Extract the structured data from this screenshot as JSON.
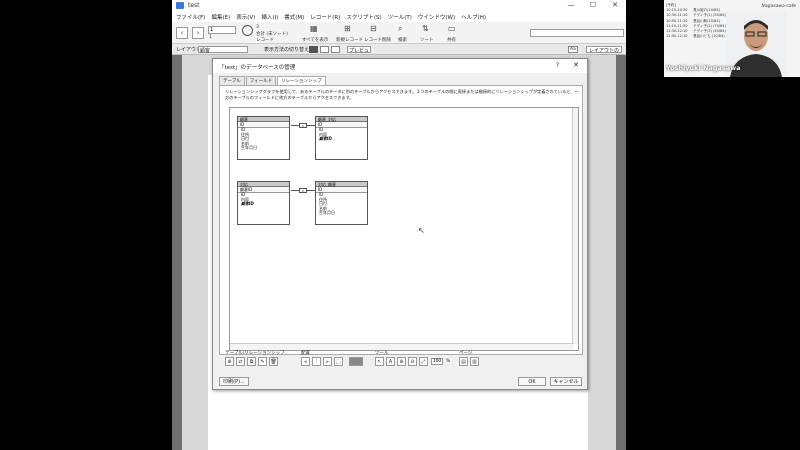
{
  "window": {
    "title": "test"
  },
  "menu": [
    "ファイル(F)",
    "編集(E)",
    "表示(V)",
    "挿入(I)",
    "書式(M)",
    "レコード(R)",
    "スクリプト(S)",
    "ツール(T)",
    "ウインドウ(W)",
    "ヘルプ(H)"
  ],
  "toolbar": {
    "record_number": "1",
    "record_total": "1",
    "found_count": "3",
    "found_label": "合計 (未ソート)",
    "records_label": "レコード",
    "show_all": "すべてを表示",
    "new_record": "新規レコード",
    "delete_record": "レコード削除",
    "find": "検索",
    "sort": "ソート",
    "share": "共有"
  },
  "layoutbar": {
    "layout_label": "レイアウト:",
    "layout_value": "顧客",
    "view_label": "表示方法の切り替え:",
    "preview": "プレビュー",
    "aa": "Aa",
    "edit_layout": "レイアウトの編集"
  },
  "dialog": {
    "title": "「test」のデータベースの管理",
    "help": "?",
    "close": "✕",
    "tabs": [
      "テーブル",
      "フィールド",
      "リレーションシップ"
    ],
    "active_tab": 2,
    "description": "リレーションシップグラフを使用して、あるテーブルのデータに別のテーブルからアクセスできます。２つのテーブルの間に直接または間接的にリレーションシップが定義されていると、一方のテーブルのフィールドに他方のテーブルからアクセスできます。",
    "tables": [
      {
        "name": "顧客",
        "key": "ID",
        "fields": [
          "ID",
          "住所",
          "日付",
          "名前",
          "生年月日"
        ],
        "italic": []
      },
      {
        "name": "顧客_対応",
        "key": "ID",
        "fields": [
          "ID",
          "内容",
          "顧客ID"
        ],
        "italic": [
          "顧客ID"
        ]
      },
      {
        "name": "対応",
        "key": "顧客ID",
        "fields": [
          "ID",
          "内容",
          "顧客ID"
        ],
        "italic": [
          "顧客ID"
        ]
      },
      {
        "name": "対応_顧客",
        "key": "ID",
        "fields": [
          "ID",
          "住所",
          "日付",
          "名前",
          "生年月日"
        ],
        "italic": []
      }
    ],
    "bottom_sections": {
      "tables_label": "テーブル/リレーションシップ",
      "arrange_label": "配置",
      "tools_label": "ツール",
      "page_label": "ページ",
      "zoom": "100",
      "percent": "%"
    },
    "print_button": "印刷(P)...",
    "ok_button": "OK",
    "cancel_button": "キャンセル"
  },
  "webcam": {
    "name": "Yoshiyuki Nagasawa",
    "logo": "Nagasawa-cafe",
    "header": "[予約]",
    "schedule": [
      "10:10-10:30 　 長川裕介(10/84)",
      "10:30-11:10 　 テディ子(1) (50/84)",
      "10:50-11:30 　 長谷川和(10/84)",
      "11:10-11:50 　 テディ子(2) (70/84)",
      "11:30-12:10 　 テディ子(3) (40/84)",
      "12:00-12:10 　 長谷川とも (10/84)"
    ]
  }
}
